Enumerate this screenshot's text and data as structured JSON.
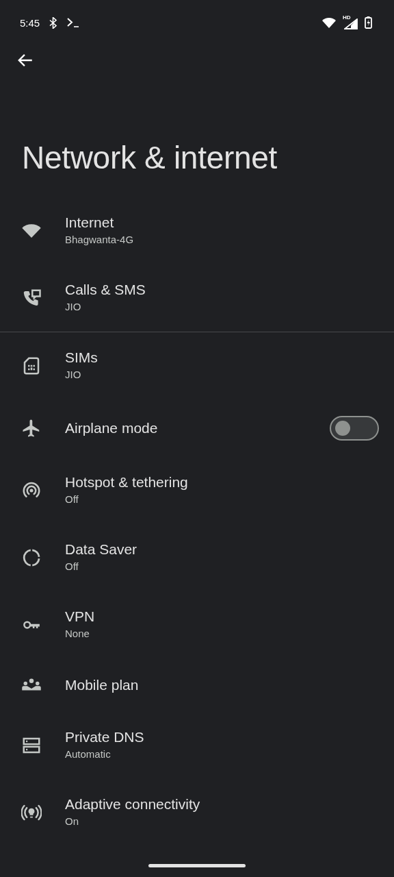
{
  "status_bar": {
    "time": "5:45",
    "network_label": "HD"
  },
  "page": {
    "title": "Network & internet"
  },
  "groups": [
    [
      {
        "kind": "link",
        "title": "Internet",
        "subtitle": "Bhagwanta-4G"
      },
      {
        "kind": "link",
        "title": "Calls & SMS",
        "subtitle": "JIO"
      }
    ],
    [
      {
        "kind": "link",
        "title": "SIMs",
        "subtitle": "JIO"
      },
      {
        "kind": "switch",
        "title": "Airplane mode",
        "on": false
      },
      {
        "kind": "link",
        "title": "Hotspot & tethering",
        "subtitle": "Off"
      },
      {
        "kind": "link",
        "title": "Data Saver",
        "subtitle": "Off"
      },
      {
        "kind": "link",
        "title": "VPN",
        "subtitle": "None"
      },
      {
        "kind": "link",
        "title": "Mobile plan"
      },
      {
        "kind": "link",
        "title": "Private DNS",
        "subtitle": "Automatic"
      },
      {
        "kind": "link",
        "title": "Adaptive connectivity",
        "subtitle": "On"
      }
    ]
  ]
}
